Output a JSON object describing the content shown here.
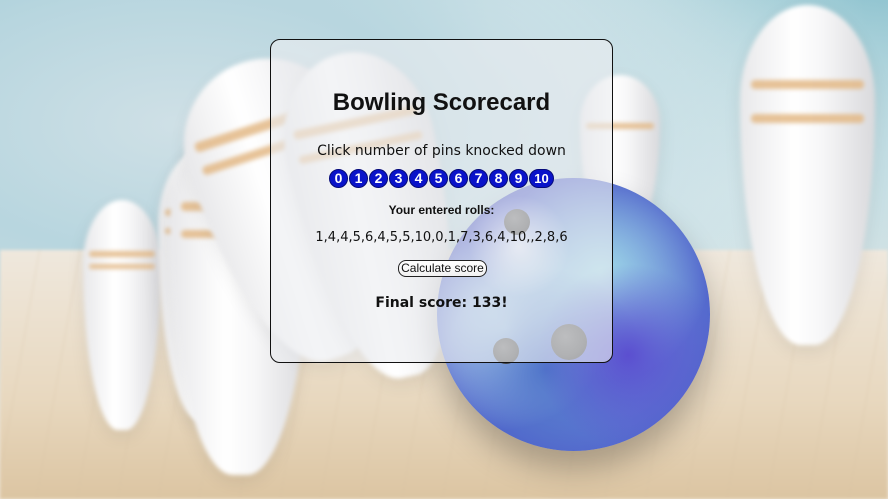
{
  "page": {
    "title": "Bowling Scorecard",
    "instruction": "Click number of pins knocked down",
    "pin_buttons": [
      "0",
      "1",
      "2",
      "3",
      "4",
      "5",
      "6",
      "7",
      "8",
      "9",
      "10"
    ],
    "rolls_label": "Your entered rolls:",
    "rolls_value": "1,4,4,5,6,4,5,5,10,0,1,7,3,6,4,10,,2,8,6",
    "calculate_button": "Calculate score",
    "final_score": "Final score: 133!"
  },
  "colors": {
    "pin_button_bg": "#0a13c9",
    "card_bg": "rgba(235,238,240,0.62)"
  }
}
